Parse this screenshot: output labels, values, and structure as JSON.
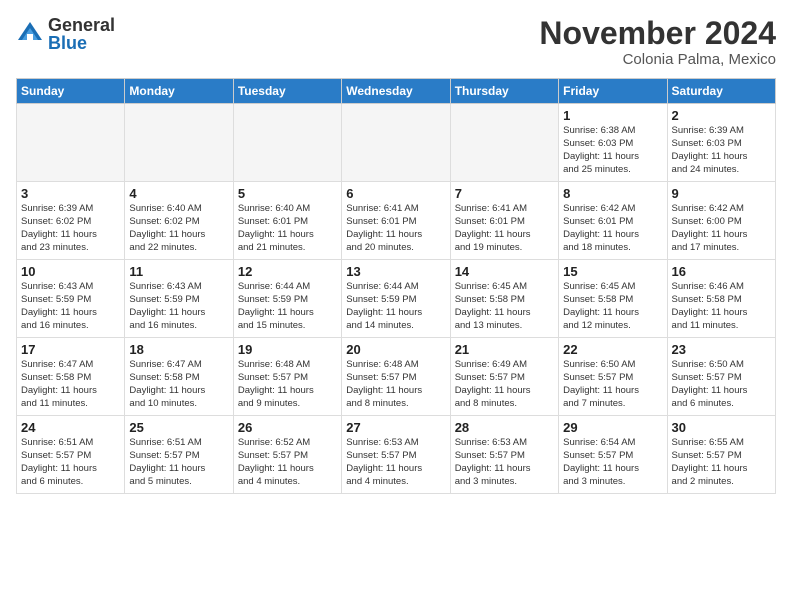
{
  "logo": {
    "general": "General",
    "blue": "Blue"
  },
  "title": "November 2024",
  "location": "Colonia Palma, Mexico",
  "days_header": [
    "Sunday",
    "Monday",
    "Tuesday",
    "Wednesday",
    "Thursday",
    "Friday",
    "Saturday"
  ],
  "weeks": [
    [
      {
        "day": "",
        "info": "",
        "empty": true
      },
      {
        "day": "",
        "info": "",
        "empty": true
      },
      {
        "day": "",
        "info": "",
        "empty": true
      },
      {
        "day": "",
        "info": "",
        "empty": true
      },
      {
        "day": "",
        "info": "",
        "empty": true
      },
      {
        "day": "1",
        "info": "Sunrise: 6:38 AM\nSunset: 6:03 PM\nDaylight: 11 hours\nand 25 minutes.",
        "empty": false
      },
      {
        "day": "2",
        "info": "Sunrise: 6:39 AM\nSunset: 6:03 PM\nDaylight: 11 hours\nand 24 minutes.",
        "empty": false
      }
    ],
    [
      {
        "day": "3",
        "info": "Sunrise: 6:39 AM\nSunset: 6:02 PM\nDaylight: 11 hours\nand 23 minutes.",
        "empty": false
      },
      {
        "day": "4",
        "info": "Sunrise: 6:40 AM\nSunset: 6:02 PM\nDaylight: 11 hours\nand 22 minutes.",
        "empty": false
      },
      {
        "day": "5",
        "info": "Sunrise: 6:40 AM\nSunset: 6:01 PM\nDaylight: 11 hours\nand 21 minutes.",
        "empty": false
      },
      {
        "day": "6",
        "info": "Sunrise: 6:41 AM\nSunset: 6:01 PM\nDaylight: 11 hours\nand 20 minutes.",
        "empty": false
      },
      {
        "day": "7",
        "info": "Sunrise: 6:41 AM\nSunset: 6:01 PM\nDaylight: 11 hours\nand 19 minutes.",
        "empty": false
      },
      {
        "day": "8",
        "info": "Sunrise: 6:42 AM\nSunset: 6:01 PM\nDaylight: 11 hours\nand 18 minutes.",
        "empty": false
      },
      {
        "day": "9",
        "info": "Sunrise: 6:42 AM\nSunset: 6:00 PM\nDaylight: 11 hours\nand 17 minutes.",
        "empty": false
      }
    ],
    [
      {
        "day": "10",
        "info": "Sunrise: 6:43 AM\nSunset: 5:59 PM\nDaylight: 11 hours\nand 16 minutes.",
        "empty": false
      },
      {
        "day": "11",
        "info": "Sunrise: 6:43 AM\nSunset: 5:59 PM\nDaylight: 11 hours\nand 16 minutes.",
        "empty": false
      },
      {
        "day": "12",
        "info": "Sunrise: 6:44 AM\nSunset: 5:59 PM\nDaylight: 11 hours\nand 15 minutes.",
        "empty": false
      },
      {
        "day": "13",
        "info": "Sunrise: 6:44 AM\nSunset: 5:59 PM\nDaylight: 11 hours\nand 14 minutes.",
        "empty": false
      },
      {
        "day": "14",
        "info": "Sunrise: 6:45 AM\nSunset: 5:58 PM\nDaylight: 11 hours\nand 13 minutes.",
        "empty": false
      },
      {
        "day": "15",
        "info": "Sunrise: 6:45 AM\nSunset: 5:58 PM\nDaylight: 11 hours\nand 12 minutes.",
        "empty": false
      },
      {
        "day": "16",
        "info": "Sunrise: 6:46 AM\nSunset: 5:58 PM\nDaylight: 11 hours\nand 11 minutes.",
        "empty": false
      }
    ],
    [
      {
        "day": "17",
        "info": "Sunrise: 6:47 AM\nSunset: 5:58 PM\nDaylight: 11 hours\nand 11 minutes.",
        "empty": false
      },
      {
        "day": "18",
        "info": "Sunrise: 6:47 AM\nSunset: 5:58 PM\nDaylight: 11 hours\nand 10 minutes.",
        "empty": false
      },
      {
        "day": "19",
        "info": "Sunrise: 6:48 AM\nSunset: 5:57 PM\nDaylight: 11 hours\nand 9 minutes.",
        "empty": false
      },
      {
        "day": "20",
        "info": "Sunrise: 6:48 AM\nSunset: 5:57 PM\nDaylight: 11 hours\nand 8 minutes.",
        "empty": false
      },
      {
        "day": "21",
        "info": "Sunrise: 6:49 AM\nSunset: 5:57 PM\nDaylight: 11 hours\nand 8 minutes.",
        "empty": false
      },
      {
        "day": "22",
        "info": "Sunrise: 6:50 AM\nSunset: 5:57 PM\nDaylight: 11 hours\nand 7 minutes.",
        "empty": false
      },
      {
        "day": "23",
        "info": "Sunrise: 6:50 AM\nSunset: 5:57 PM\nDaylight: 11 hours\nand 6 minutes.",
        "empty": false
      }
    ],
    [
      {
        "day": "24",
        "info": "Sunrise: 6:51 AM\nSunset: 5:57 PM\nDaylight: 11 hours\nand 6 minutes.",
        "empty": false
      },
      {
        "day": "25",
        "info": "Sunrise: 6:51 AM\nSunset: 5:57 PM\nDaylight: 11 hours\nand 5 minutes.",
        "empty": false
      },
      {
        "day": "26",
        "info": "Sunrise: 6:52 AM\nSunset: 5:57 PM\nDaylight: 11 hours\nand 4 minutes.",
        "empty": false
      },
      {
        "day": "27",
        "info": "Sunrise: 6:53 AM\nSunset: 5:57 PM\nDaylight: 11 hours\nand 4 minutes.",
        "empty": false
      },
      {
        "day": "28",
        "info": "Sunrise: 6:53 AM\nSunset: 5:57 PM\nDaylight: 11 hours\nand 3 minutes.",
        "empty": false
      },
      {
        "day": "29",
        "info": "Sunrise: 6:54 AM\nSunset: 5:57 PM\nDaylight: 11 hours\nand 3 minutes.",
        "empty": false
      },
      {
        "day": "30",
        "info": "Sunrise: 6:55 AM\nSunset: 5:57 PM\nDaylight: 11 hours\nand 2 minutes.",
        "empty": false
      }
    ]
  ]
}
